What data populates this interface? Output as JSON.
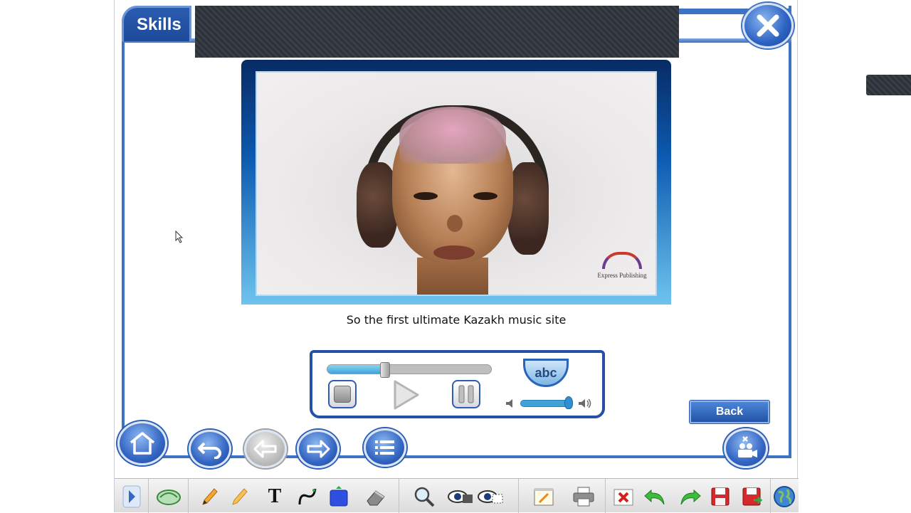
{
  "header": {
    "tab_label": "Skills"
  },
  "video": {
    "subtitle": "So the first ultimate Kazakh music site",
    "watermark": "Express Publishing"
  },
  "player": {
    "progress_fraction": 0.35,
    "volume_fraction": 0.9,
    "subtitle_toggle_label": "abc"
  },
  "buttons": {
    "back_label": "Back"
  },
  "colors": {
    "accent": "#3e72c4",
    "dark": "#2d3138"
  },
  "toolbar": {
    "icons": [
      "expand-arrow-icon",
      "mouse-pointer-icon",
      "pencil-icon",
      "highlighter-icon",
      "text-tool-icon",
      "curve-tool-icon",
      "shape-tool-icon",
      "eraser-icon",
      "zoom-icon",
      "spotlight-icon",
      "reveal-icon",
      "notes-icon",
      "print-icon",
      "clear-icon",
      "undo-icon",
      "redo-icon",
      "save-icon",
      "save-as-icon",
      "globe-icon"
    ],
    "text_tool_glyph": "T"
  }
}
